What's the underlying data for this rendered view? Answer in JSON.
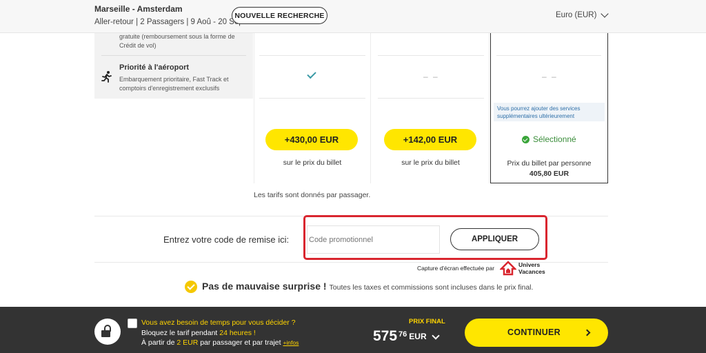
{
  "header": {
    "route": "Marseille - Amsterdam",
    "trip_info": "Aller-retour | 2 Passagers | 9 Aoû - 20 Sep",
    "new_search_label": "NOUVELLE RECHERCHE",
    "currency": "Euro (EUR)"
  },
  "features": {
    "top_partial_text": "gratuite (remboursement sous la forme de Crédit de vol)",
    "priority_title": "Priorité à l'aéroport",
    "priority_desc": "Embarquement prioritaire, Fast Track et comptoirs d'enregistrement exclusifs"
  },
  "fares": [
    {
      "price": "+430,00 EUR",
      "sub": "sur le prix du billet",
      "priority": "check"
    },
    {
      "price": "+142,00 EUR",
      "sub": "sur le prix du billet",
      "priority": "– –"
    },
    {
      "priority": "– –",
      "note": "Vous pourrez ajouter des services supplémentaires ultérieurement",
      "status": "Sélectionné",
      "sub": "Prix du billet par personne",
      "price": "405,80 EUR"
    }
  ],
  "rates_note": "Les tarifs sont donnés par passager.",
  "promo": {
    "label": "Entrez votre code de remise ici:",
    "placeholder": "Code promotionnel",
    "apply_label": "APPLIQUER"
  },
  "watermark": {
    "caption": "Capture d'écran effectuée par",
    "brand_line1": "Univers",
    "brand_line2": "Vacances"
  },
  "surprise": {
    "title": "Pas de mauvaise surprise !",
    "text": "Toutes les taxes et commissions sont incluses dans le prix final."
  },
  "footer": {
    "hold_line1": "Vous avez besoin de temps pour vous décider ?",
    "hold_line2_a": "Bloquez le tarif pendant ",
    "hold_line2_b": "24 heures !",
    "hold_line3_a": "À partir de ",
    "hold_line3_b": "2 EUR",
    "hold_line3_c": " par passager et par trajet ",
    "infos": "+infos",
    "final_label": "PRIX FINAL",
    "total_int": "575",
    "total_dec": "76",
    "total_currency": "EUR",
    "continue_label": "CONTINUER"
  },
  "colors": {
    "accent_yellow": "#ffe600",
    "footer_bg": "#333333",
    "highlight_red": "#d9262f",
    "selected_green": "#3aa53a",
    "check_teal": "#3a9aa6"
  }
}
